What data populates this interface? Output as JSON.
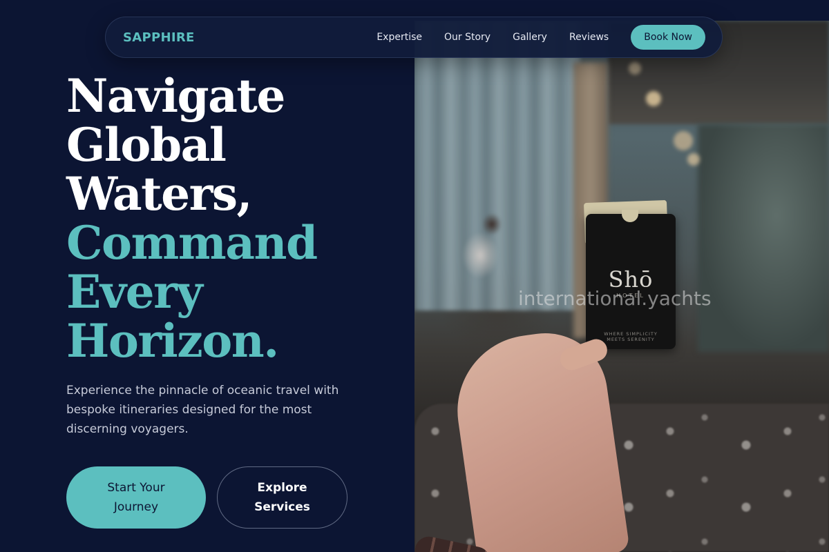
{
  "brand": {
    "name": "SAPPHIRE"
  },
  "nav": {
    "links": [
      "Expertise",
      "Our Story",
      "Gallery",
      "Reviews"
    ],
    "cta_label": "Book Now"
  },
  "hero": {
    "headline_lines_white": [
      "Navigate",
      "Global",
      "Waters,"
    ],
    "headline_lines_accent": [
      "Command",
      "Every",
      "Horizon."
    ],
    "subtext": "Experience the pinnacle of oceanic travel with bespoke itineraries designed for the most discerning voyagers.",
    "primary_button": "Start Your\nJourney",
    "secondary_button": "Explore\nServices"
  },
  "photo": {
    "keycard_brand": "Shō",
    "keycard_sub": "HOTEL",
    "keycard_tagline": "WHERE SIMPLICITY\nMEETS SERENITY",
    "watermark": "international.yachts"
  },
  "colors": {
    "background": "#0c1533",
    "accent": "#5cbfbf",
    "text_primary": "#ffffff",
    "text_muted": "#c7cbd9"
  }
}
